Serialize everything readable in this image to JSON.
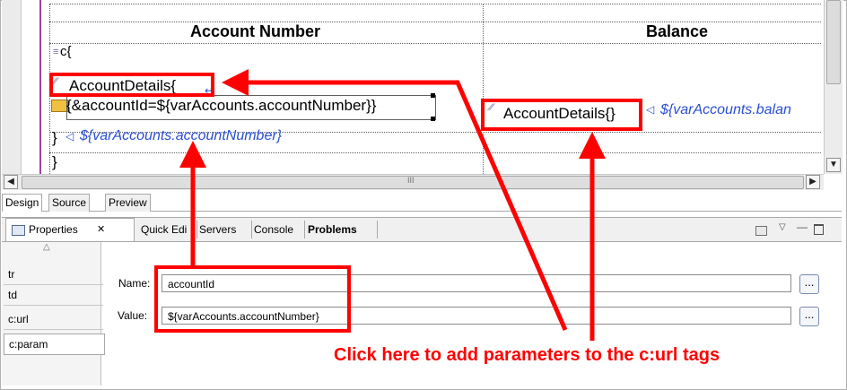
{
  "table": {
    "col1_header": "Account Number",
    "col2_header": "Balance"
  },
  "code": {
    "line1_icon": "c",
    "line1_brace": "{",
    "line2_text": "AccountDetails{",
    "line3_text": "{&accountId=${varAccounts.accountNumber}}",
    "line4_brace": "}",
    "line4_expr": "${varAccounts.accountNumber}",
    "line5_brace": "}",
    "col2_text": "AccountDetails{}",
    "col2_expr": "${varAccounts.balan"
  },
  "editor_tabs": [
    "Design",
    "Source",
    "Preview"
  ],
  "view_tabs": {
    "properties": "Properties",
    "quick_edit": "Quick Edi",
    "servers": "Servers",
    "console": "Console",
    "problems": "Problems"
  },
  "left_list": [
    "tr",
    "td",
    "c:url",
    "c:param"
  ],
  "properties": {
    "name_label": "Name:",
    "name_value": "accountId",
    "value_label": "Value:",
    "value_value": "${varAccounts.accountNumber}",
    "browse_label": "..."
  },
  "hscroll_center": "III",
  "callout": "Click here to add parameters to the c:url tags",
  "colors": {
    "annotation": "#ff0000",
    "expression": "#2a4fd0"
  }
}
